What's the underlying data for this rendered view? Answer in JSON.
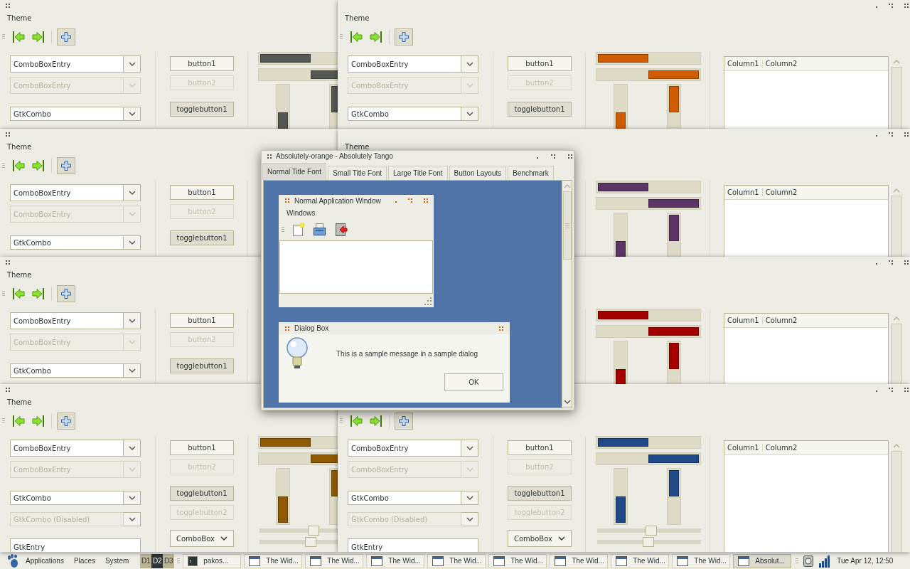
{
  "windows": [
    {
      "menu": [
        "Theme"
      ],
      "toolbar": [
        {
          "selected": false
        },
        {
          "selected": false
        },
        {
          "selected": true
        }
      ],
      "color": "#555753",
      "fields": [
        {
          "kind": "combo_entry",
          "text": "ComboBoxEntry",
          "disabled": false
        },
        {
          "kind": "combo_entry",
          "text": "ComboBoxEntry",
          "disabled": true
        },
        {
          "kind": "combo",
          "text": "GtkCombo",
          "disabled": false
        }
      ],
      "buttons": [
        {
          "kind": "button",
          "label": "button1",
          "disabled": false
        },
        {
          "kind": "button",
          "label": "button2",
          "disabled": true
        },
        {
          "kind": "toggle",
          "label": "togglebutton1",
          "disabled": false,
          "pressed": true
        }
      ],
      "progress": [
        {
          "kind": "left_to_right",
          "level": 0.5
        },
        {
          "kind": "right_to_left",
          "level": 0.5
        },
        {
          "kind": "bottom_to_top",
          "level": 0.5
        },
        {
          "kind": "top_to_bottom",
          "level": 0.5
        }
      ]
    },
    {
      "menu": [
        "Theme"
      ],
      "toolbar": [
        {
          "selected": false
        },
        {
          "selected": false
        },
        {
          "selected": true
        }
      ],
      "color": "#ce5c00",
      "fields": [
        {
          "kind": "combo_entry",
          "text": "ComboBoxEntry",
          "disabled": false
        },
        {
          "kind": "combo_entry",
          "text": "ComboBoxEntry",
          "disabled": true
        },
        {
          "kind": "combo",
          "text": "GtkCombo",
          "disabled": false
        }
      ],
      "buttons": [
        {
          "kind": "button",
          "label": "button1",
          "disabled": false
        },
        {
          "kind": "button",
          "label": "button2",
          "disabled": true
        },
        {
          "kind": "toggle",
          "label": "togglebutton1",
          "disabled": false,
          "pressed": true
        }
      ],
      "progress": [
        {
          "kind": "left_to_right",
          "level": 0.5
        },
        {
          "kind": "right_to_left",
          "level": 0.5
        },
        {
          "kind": "bottom_to_top",
          "level": 0.5
        },
        {
          "kind": "top_to_bottom",
          "level": 0.5
        }
      ],
      "tree": {
        "columns": [
          "Column1",
          "Column2"
        ]
      }
    },
    {
      "menu": [
        "Theme"
      ],
      "toolbar": [
        {
          "selected": false
        },
        {
          "selected": false
        },
        {
          "selected": true
        }
      ],
      "fields": [
        {
          "kind": "combo_entry",
          "text": "ComboBoxEntry",
          "disabled": false
        },
        {
          "kind": "combo_entry",
          "text": "ComboBoxEntry",
          "disabled": true
        },
        {
          "kind": "combo",
          "text": "GtkCombo",
          "disabled": false
        }
      ],
      "buttons": [
        {
          "kind": "button",
          "label": "button1",
          "disabled": false
        },
        {
          "kind": "button",
          "label": "button2",
          "disabled": true
        },
        {
          "kind": "toggle",
          "label": "togglebutton1",
          "disabled": false,
          "pressed": true
        }
      ]
    },
    {
      "menu": [
        "Theme"
      ],
      "color": "#5c3566",
      "progress": [
        {
          "kind": "left_to_right",
          "level": 0.5
        },
        {
          "kind": "right_to_left",
          "level": 0.5
        },
        {
          "kind": "bottom_to_top",
          "level": 0.5
        },
        {
          "kind": "top_to_bottom",
          "level": 0.5
        }
      ],
      "tree": {
        "columns": [
          "Column1",
          "Column2"
        ]
      }
    },
    {
      "menu": [
        "Theme"
      ],
      "toolbar": [
        {
          "selected": false
        },
        {
          "selected": false
        },
        {
          "selected": true
        }
      ],
      "fields": [
        {
          "kind": "combo_entry",
          "text": "ComboBoxEntry",
          "disabled": false
        },
        {
          "kind": "combo_entry",
          "text": "ComboBoxEntry",
          "disabled": true
        },
        {
          "kind": "combo",
          "text": "GtkCombo",
          "disabled": false
        }
      ],
      "buttons": [
        {
          "kind": "button",
          "label": "button1",
          "disabled": false
        },
        {
          "kind": "button",
          "label": "button2",
          "disabled": true
        },
        {
          "kind": "toggle",
          "label": "togglebutton1",
          "disabled": false,
          "pressed": true
        }
      ]
    },
    {
      "color": "#a40000",
      "progress": [
        {
          "kind": "left_to_right",
          "level": 0.5
        },
        {
          "kind": "right_to_left",
          "level": 0.5
        },
        {
          "kind": "bottom_to_top",
          "level": 0.5
        },
        {
          "kind": "top_to_bottom",
          "level": 0.5
        }
      ],
      "tree": {
        "columns": [
          "Column1",
          "Column2"
        ]
      }
    },
    {
      "menu": [
        "Theme"
      ],
      "toolbar": [
        {
          "selected": false
        },
        {
          "selected": false
        },
        {
          "selected": true
        }
      ],
      "color": "#8f5902",
      "fields": [
        {
          "kind": "combo_entry",
          "text": "ComboBoxEntry",
          "disabled": false
        },
        {
          "kind": "combo_entry",
          "text": "ComboBoxEntry",
          "disabled": true
        },
        {
          "kind": "combo",
          "text": "GtkCombo",
          "disabled": false
        },
        {
          "kind": "combo",
          "text": "GtkCombo (Disabled)",
          "disabled": true
        },
        {
          "kind": "entry",
          "text": "GtkEntry",
          "disabled": false
        }
      ],
      "buttons": [
        {
          "kind": "button",
          "label": "button1",
          "disabled": false
        },
        {
          "kind": "button",
          "label": "button2",
          "disabled": true
        },
        {
          "kind": "toggle",
          "label": "togglebutton1",
          "disabled": false,
          "pressed": true
        },
        {
          "kind": "toggle",
          "label": "togglebutton2",
          "disabled": true,
          "pressed": false
        },
        {
          "kind": "dropdown",
          "label": "ComboBox",
          "disabled": false
        }
      ],
      "progress": [
        {
          "kind": "left_to_right",
          "level": 0.5
        },
        {
          "kind": "right_to_left",
          "level": 0.5
        },
        {
          "kind": "bottom_to_top",
          "level": 0.5
        },
        {
          "kind": "top_to_bottom",
          "level": 0.5
        }
      ],
      "sliders": [
        {
          "level": 0.52
        },
        {
          "level": 0.49
        }
      ]
    },
    {
      "toolbar": [
        {
          "selected": false
        },
        {
          "selected": false
        },
        {
          "selected": true
        }
      ],
      "color": "#204a87",
      "fields": [
        {
          "kind": "combo_entry",
          "text": "ComboBoxEntry",
          "disabled": false
        },
        {
          "kind": "combo_entry",
          "text": "ComboBoxEntry",
          "disabled": true
        },
        {
          "kind": "combo",
          "text": "GtkCombo",
          "disabled": false
        },
        {
          "kind": "combo",
          "text": "GtkCombo (Disabled)",
          "disabled": true
        },
        {
          "kind": "entry",
          "text": "GtkEntry",
          "disabled": false
        }
      ],
      "buttons": [
        {
          "kind": "button",
          "label": "button1",
          "disabled": false
        },
        {
          "kind": "button",
          "label": "button2",
          "disabled": true
        },
        {
          "kind": "toggle",
          "label": "togglebutton1",
          "disabled": false,
          "pressed": true
        },
        {
          "kind": "toggle",
          "label": "togglebutton2",
          "disabled": true,
          "pressed": false
        },
        {
          "kind": "dropdown",
          "label": "ComboBox",
          "disabled": false
        }
      ],
      "progress": [
        {
          "kind": "left_to_right",
          "level": 0.5
        },
        {
          "kind": "right_to_left",
          "level": 0.5
        },
        {
          "kind": "bottom_to_top",
          "level": 0.5
        },
        {
          "kind": "top_to_bottom",
          "level": 0.5
        }
      ],
      "sliders": [
        {
          "level": 0.52
        },
        {
          "level": 0.49
        }
      ],
      "tree": {
        "columns": [
          "Column1",
          "Column2"
        ]
      }
    }
  ],
  "dialog": {
    "title": "Absolutely-orange - Absolutely Tango",
    "tabs": [
      {
        "label": "Normal Title Font",
        "selected": true
      },
      {
        "label": "Small Title Font",
        "selected": false
      },
      {
        "label": "Large Title Font",
        "selected": false
      },
      {
        "label": "Button Layouts",
        "selected": false
      },
      {
        "label": "Benchmark",
        "selected": false
      }
    ],
    "app_window": {
      "title": "Normal Application Window",
      "menu": [
        "Windows"
      ]
    },
    "message_box": {
      "title": "Dialog Box",
      "message": "This is a sample message in a sample dialog",
      "buttons": [
        "OK"
      ]
    }
  },
  "panel": {
    "menus": [
      "Applications",
      "Places",
      "System"
    ],
    "workspaces": [
      {
        "label": "D1",
        "selected": false
      },
      {
        "label": "D2",
        "selected": true
      },
      {
        "label": "D3",
        "selected": false
      }
    ],
    "tasks": [
      {
        "kind": "terminal",
        "label": "pakos...",
        "selected": false
      },
      {
        "kind": "window",
        "label": "The Wid...",
        "selected": false
      },
      {
        "kind": "window",
        "label": "The Wid...",
        "selected": false
      },
      {
        "kind": "window",
        "label": "The Wid...",
        "selected": false
      },
      {
        "kind": "window",
        "label": "The Wid...",
        "selected": false
      },
      {
        "kind": "window",
        "label": "The Wid...",
        "selected": false
      },
      {
        "kind": "window",
        "label": "The Wid...",
        "selected": false
      },
      {
        "kind": "window",
        "label": "The Wid...",
        "selected": false
      },
      {
        "kind": "window",
        "label": "The Wid...",
        "selected": false
      },
      {
        "kind": "window",
        "label": "Absolut...",
        "selected": true
      }
    ],
    "clock": "Tue Apr 12, 12:50"
  }
}
